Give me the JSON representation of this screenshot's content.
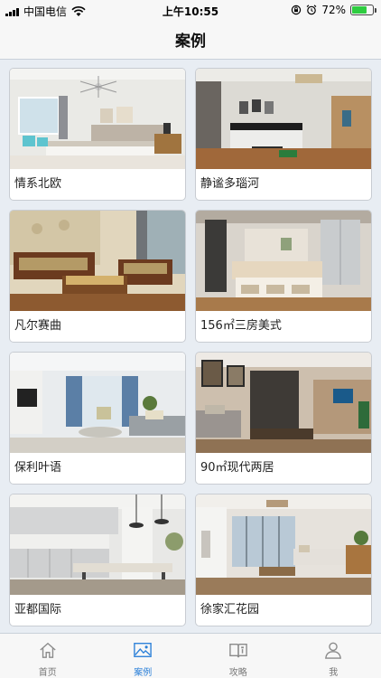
{
  "status": {
    "carrier": "中国电信",
    "time": "上午10:55",
    "battery": "72%",
    "battery_level": 0.72
  },
  "nav": {
    "title": "案例"
  },
  "cases": [
    {
      "title": "情系北欧",
      "scene": "nordic-bedroom"
    },
    {
      "title": "静谧多瑙河",
      "scene": "living-room-dark-sofa"
    },
    {
      "title": "凡尔赛曲",
      "scene": "classic-living-room"
    },
    {
      "title": "156㎡三房美式",
      "scene": "american-living-room"
    },
    {
      "title": "保利叶语",
      "scene": "bright-living-room"
    },
    {
      "title": "90㎡现代两居",
      "scene": "modern-living-room"
    },
    {
      "title": "亚都国际",
      "scene": "kitchen-dining"
    },
    {
      "title": "徐家汇花园",
      "scene": "living-room-window"
    }
  ],
  "tabs": [
    {
      "label": "首页",
      "icon": "home-icon",
      "active": false
    },
    {
      "label": "案例",
      "icon": "image-icon",
      "active": true
    },
    {
      "label": "攻略",
      "icon": "guide-book-icon",
      "active": false
    },
    {
      "label": "我",
      "icon": "person-icon",
      "active": false
    }
  ],
  "colors": {
    "accent": "#2a7fd8",
    "inactive": "#777777",
    "background": "#e8edf3"
  }
}
